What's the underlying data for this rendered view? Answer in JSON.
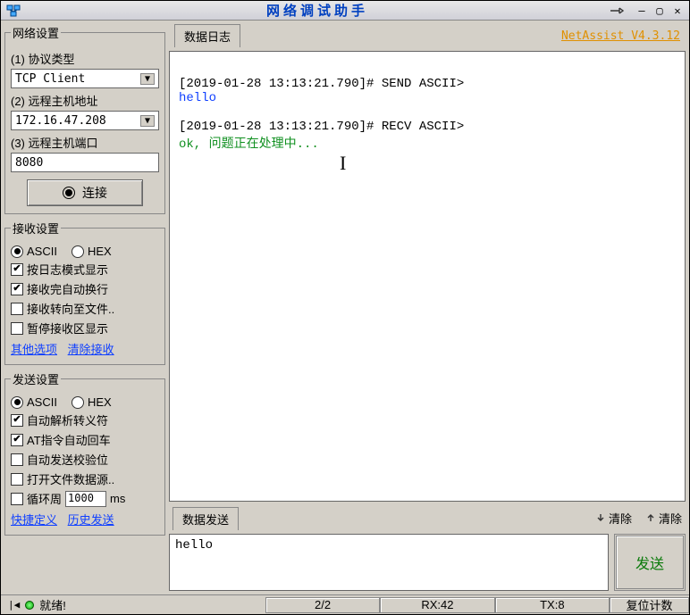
{
  "title": "网络调试助手",
  "version_link": "NetAssist V4.3.12",
  "panels": {
    "netset": {
      "legend": "网络设置",
      "proto_label": "(1) 协议类型",
      "proto_value": "TCP Client",
      "host_label": "(2) 远程主机地址",
      "host_value": "172.16.47.208",
      "port_label": "(3) 远程主机端口",
      "port_value": "8080",
      "connect_btn": "连接"
    },
    "recv": {
      "legend": "接收设置",
      "ascii": "ASCII",
      "hex": "HEX",
      "opt1": "按日志模式显示",
      "opt2": "接收完自动换行",
      "opt3": "接收转向至文件..",
      "opt4": "暂停接收区显示",
      "link1": "其他选项",
      "link2": "清除接收"
    },
    "send": {
      "legend": "发送设置",
      "ascii": "ASCII",
      "hex": "HEX",
      "opt1": "自动解析转义符",
      "opt2": "AT指令自动回车",
      "opt3": "自动发送校验位",
      "opt4": "打开文件数据源..",
      "cycle_label": "循环周",
      "cycle_value": "1000",
      "cycle_unit": "ms",
      "link1": "快捷定义",
      "link2": "历史发送"
    }
  },
  "right": {
    "log_tab": "数据日志",
    "send_tab": "数据发送",
    "clear1": "清除",
    "clear2": "清除",
    "send_btn": "发送",
    "send_input": "hello"
  },
  "log": {
    "line1": "[2019-01-28 13:13:21.790]# SEND ASCII>",
    "data1": "hello",
    "line2": "[2019-01-28 13:13:21.790]# RECV ASCII>",
    "data2": "ok, 问题正在处理中..."
  },
  "status": {
    "ready": "就绪!",
    "counter": "2/2",
    "rx": "RX:42",
    "tx": "TX:8",
    "reset": "复位计数"
  }
}
